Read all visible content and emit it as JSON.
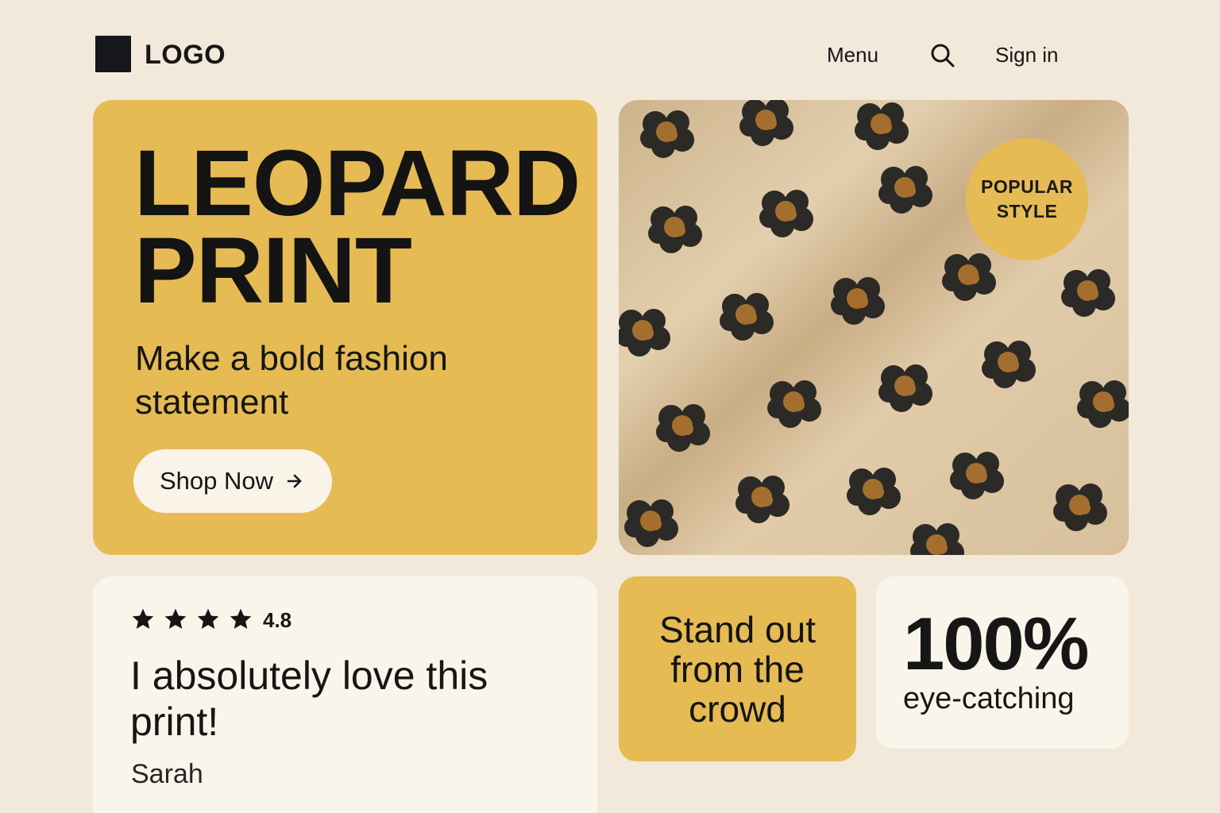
{
  "header": {
    "logo_text": "LOGO",
    "menu_label": "Menu",
    "search_icon": "search-icon",
    "signin_label": "Sign in"
  },
  "hero": {
    "title_line1": "LEOPARD",
    "title_line2": "PRINT",
    "subtitle": "Make a bold fashion statement",
    "cta_label": "Shop Now",
    "cta_icon": "arrow-right-icon"
  },
  "photo": {
    "badge_line1": "POPULAR",
    "badge_line2": "STYLE"
  },
  "review": {
    "stars": 4,
    "rating": "4.8",
    "quote": "I absolutely love this print!",
    "author": "Sarah"
  },
  "standout": {
    "text": "Stand out from the crowd"
  },
  "stat": {
    "value": "100%",
    "label": "eye-catching"
  },
  "colors": {
    "background": "#f2e9db",
    "accent": "#e6bb54",
    "card": "#faf5ea",
    "ink": "#151515"
  }
}
